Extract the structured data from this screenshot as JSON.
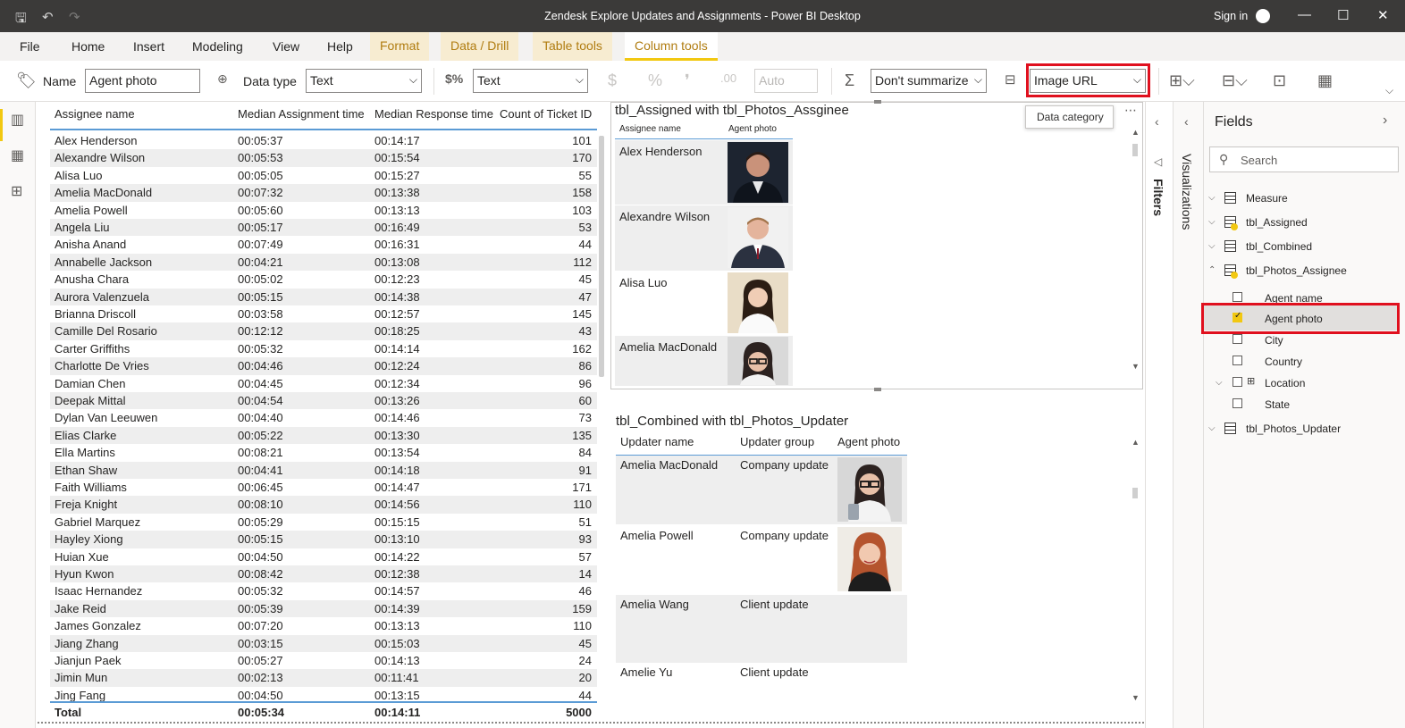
{
  "window": {
    "title": "Zendesk Explore Updates and Assignments - Power BI Desktop",
    "signin": "Sign in"
  },
  "ribbon_tabs": [
    "File",
    "Home",
    "Insert",
    "Modeling",
    "View",
    "Help",
    "Format",
    "Data / Drill",
    "Table tools",
    "Column tools"
  ],
  "active_tab": "Column tools",
  "ribbon": {
    "name_label": "Name",
    "name_value": "Agent photo",
    "datatype_label": "Data type",
    "datatype_value": "Text",
    "format_value": "Text",
    "decimals_value": "Auto",
    "summarize_value": "Don't summarize",
    "category_value": "Image URL",
    "tooltip": "Data category"
  },
  "main_table": {
    "columns": [
      "Assignee name",
      "Median Assignment time",
      "Median Response time",
      "Count of Ticket ID"
    ],
    "rows": [
      [
        "Alex Henderson",
        "00:05:37",
        "00:14:17",
        "101"
      ],
      [
        "Alexandre Wilson",
        "00:05:53",
        "00:15:54",
        "170"
      ],
      [
        "Alisa Luo",
        "00:05:05",
        "00:15:27",
        "55"
      ],
      [
        "Amelia MacDonald",
        "00:07:32",
        "00:13:38",
        "158"
      ],
      [
        "Amelia Powell",
        "00:05:60",
        "00:13:13",
        "103"
      ],
      [
        "Angela Liu",
        "00:05:17",
        "00:16:49",
        "53"
      ],
      [
        "Anisha Anand",
        "00:07:49",
        "00:16:31",
        "44"
      ],
      [
        "Annabelle Jackson",
        "00:04:21",
        "00:13:08",
        "112"
      ],
      [
        "Anusha Chara",
        "00:05:02",
        "00:12:23",
        "45"
      ],
      [
        "Aurora Valenzuela",
        "00:05:15",
        "00:14:38",
        "47"
      ],
      [
        "Brianna Driscoll",
        "00:03:58",
        "00:12:57",
        "145"
      ],
      [
        "Camille Del Rosario",
        "00:12:12",
        "00:18:25",
        "43"
      ],
      [
        "Carter Griffiths",
        "00:05:32",
        "00:14:14",
        "162"
      ],
      [
        "Charlotte De Vries",
        "00:04:46",
        "00:12:24",
        "86"
      ],
      [
        "Damian Chen",
        "00:04:45",
        "00:12:34",
        "96"
      ],
      [
        "Deepak Mittal",
        "00:04:54",
        "00:13:26",
        "60"
      ],
      [
        "Dylan Van Leeuwen",
        "00:04:40",
        "00:14:46",
        "73"
      ],
      [
        "Elias Clarke",
        "00:05:22",
        "00:13:30",
        "135"
      ],
      [
        "Ella Martins",
        "00:08:21",
        "00:13:54",
        "84"
      ],
      [
        "Ethan Shaw",
        "00:04:41",
        "00:14:18",
        "91"
      ],
      [
        "Faith Williams",
        "00:06:45",
        "00:14:47",
        "171"
      ],
      [
        "Freja Knight",
        "00:08:10",
        "00:14:56",
        "110"
      ],
      [
        "Gabriel Marquez",
        "00:05:29",
        "00:15:15",
        "51"
      ],
      [
        "Hayley Xiong",
        "00:05:15",
        "00:13:10",
        "93"
      ],
      [
        "Huian Xue",
        "00:04:50",
        "00:14:22",
        "57"
      ],
      [
        "Hyun Kwon",
        "00:08:42",
        "00:12:38",
        "14"
      ],
      [
        "Isaac Hernandez",
        "00:05:32",
        "00:14:57",
        "46"
      ],
      [
        "Jake Reid",
        "00:05:39",
        "00:14:39",
        "159"
      ],
      [
        "James Gonzalez",
        "00:07:20",
        "00:13:13",
        "110"
      ],
      [
        "Jiang Zhang",
        "00:03:15",
        "00:15:03",
        "45"
      ],
      [
        "Jianjun Paek",
        "00:05:27",
        "00:14:13",
        "24"
      ],
      [
        "Jimin Mun",
        "00:02:13",
        "00:11:41",
        "20"
      ],
      [
        "Jing Fang",
        "00:04:50",
        "00:13:15",
        "44"
      ]
    ],
    "total": [
      "Total",
      "00:05:34",
      "00:14:11",
      "5000"
    ]
  },
  "visual1": {
    "title": "tbl_Assigned with tbl_Photos_Assginee",
    "columns": [
      "Assignee name",
      "Agent photo"
    ],
    "rows": [
      "Alex Henderson",
      "Alexandre Wilson",
      "Alisa Luo",
      "Amelia MacDonald"
    ]
  },
  "visual2": {
    "title": "tbl_Combined with tbl_Photos_Updater",
    "columns": [
      "Updater name",
      "Updater group",
      "Agent photo"
    ],
    "rows": [
      [
        "Amelia MacDonald",
        "Company update"
      ],
      [
        "Amelia Powell",
        "Company update"
      ],
      [
        "Amelia Wang",
        "Client update"
      ],
      [
        "Amelie Yu",
        "Client update"
      ]
    ]
  },
  "panes": {
    "filters": "Filters",
    "visualizations": "Visualizations",
    "fields_title": "Fields",
    "search_placeholder": "Search"
  },
  "fields_tree": {
    "tables": [
      "Measure",
      "tbl_Assigned",
      "tbl_Combined",
      "tbl_Photos_Assignee",
      "tbl_Photos_Updater"
    ],
    "columns": [
      "Agent name",
      "Agent photo",
      "City",
      "Country",
      "Location",
      "State"
    ]
  },
  "colors": {
    "accent": "#f2c811",
    "highlight_red": "#e0101e",
    "titlebar": "#3b3a39",
    "header_line": "#5b9bd5"
  }
}
